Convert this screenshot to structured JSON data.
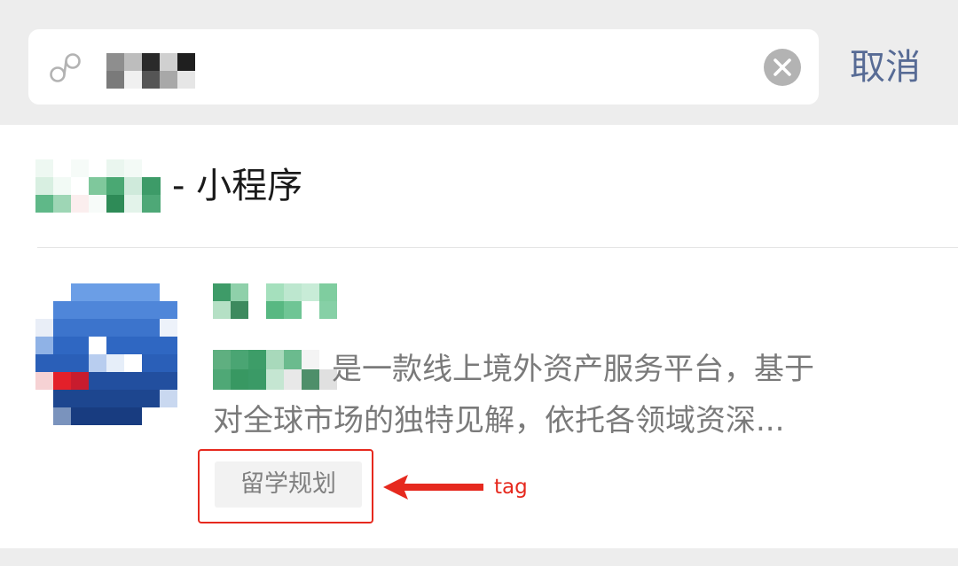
{
  "search": {
    "cancel_label": "取消"
  },
  "section": {
    "title": "- 小程序"
  },
  "result": {
    "desc_line1": "是一款线上境外资产服务平台，基于",
    "desc_line2": "对全球市场的独特见解，依托各领域资深...",
    "tag": "留学规划"
  },
  "annotation": {
    "label": "tag"
  },
  "colors": {
    "page_bg": "#ededed",
    "link_blue": "#576b95",
    "annotation_red": "#e6291e",
    "tag_bg": "#f2f2f2"
  },
  "icons": {
    "search": "miniprogram-link-icon",
    "clear": "clear-circle-icon"
  }
}
